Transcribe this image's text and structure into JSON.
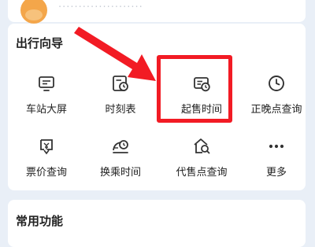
{
  "top": {
    "text": "·····················"
  },
  "guide": {
    "title": "出行向导",
    "items": [
      {
        "label": "车站大屏",
        "icon": "monitor-icon"
      },
      {
        "label": "时刻表",
        "icon": "timetable-icon"
      },
      {
        "label": "起售时间",
        "icon": "ticket-clock-icon"
      },
      {
        "label": "正晚点查询",
        "icon": "clock-icon"
      },
      {
        "label": "票价查询",
        "icon": "fare-icon"
      },
      {
        "label": "换乘时间",
        "icon": "transfer-time-icon"
      },
      {
        "label": "代售点查询",
        "icon": "agency-search-icon"
      },
      {
        "label": "更多",
        "icon": "more-icon"
      }
    ]
  },
  "common": {
    "title": "常用功能"
  },
  "colors": {
    "annotation": "#f21b24",
    "background": "#e9eff7"
  }
}
